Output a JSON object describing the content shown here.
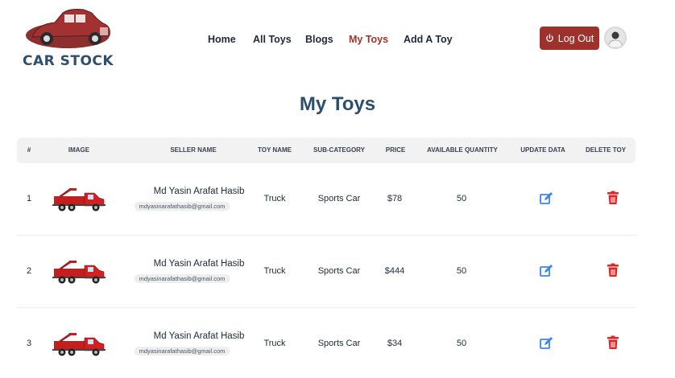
{
  "header": {
    "logo_text": "CAR STOCK",
    "nav": [
      {
        "label": "Home",
        "active": false
      },
      {
        "label": "All Toys",
        "active": false
      },
      {
        "label": "Blogs",
        "active": false
      },
      {
        "label": "My Toys",
        "active": true
      },
      {
        "label": "Add A Toy",
        "active": false
      }
    ],
    "logout_label": "Log Out",
    "logout_icon": "power-icon"
  },
  "page_title": "My Toys",
  "table": {
    "columns": [
      "#",
      "Image",
      "Seller Name",
      "Toy Name",
      "Sub-Category",
      "Price",
      "Available Quantity",
      "Update Data",
      "Delete Toy"
    ],
    "rows": [
      {
        "index": "1",
        "seller_name": "Md Yasin Arafat Hasib",
        "seller_email": "mdyasinarafathasib@gmail.com",
        "toy_name": "Truck",
        "sub_category": "Sports Car",
        "price": "$78",
        "quantity": "50"
      },
      {
        "index": "2",
        "seller_name": "Md Yasin Arafat Hasib",
        "seller_email": "mdyasinarafathasib@gmail.com",
        "toy_name": "Truck",
        "sub_category": "Sports Car",
        "price": "$444",
        "quantity": "50"
      },
      {
        "index": "3",
        "seller_name": "Md Yasin Arafat Hasib",
        "seller_email": "mdyasinarafathasib@gmail.com",
        "toy_name": "Truck",
        "sub_category": "Sports Car",
        "price": "$34",
        "quantity": "50"
      }
    ]
  },
  "colors": {
    "brand": "#2c4f70",
    "accent": "#9d322c",
    "edit": "#3b82f6",
    "delete": "#dc2626"
  }
}
